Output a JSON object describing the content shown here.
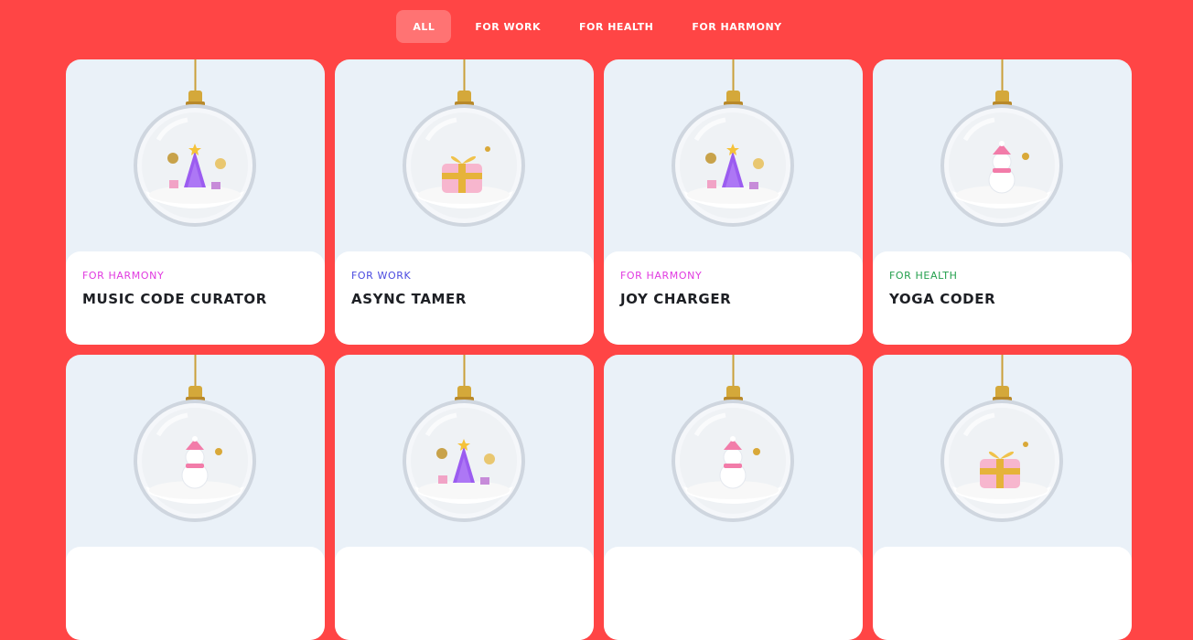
{
  "tabs": [
    {
      "label": "ALL",
      "active": true
    },
    {
      "label": "FOR WORK",
      "active": false
    },
    {
      "label": "FOR HEALTH",
      "active": false
    },
    {
      "label": "FOR HARMONY",
      "active": false
    }
  ],
  "colors": {
    "background": "#ff4545",
    "harmony": "#e13be0",
    "work": "#4a4ae0",
    "health": "#25a04e",
    "card_image_bg": "#eaf1f8"
  },
  "cards": [
    {
      "category": "FOR HARMONY",
      "category_color": "#e13be0",
      "title": "MUSIC CODE CURATOR",
      "ornament": "tree-ornament-icon"
    },
    {
      "category": "FOR WORK",
      "category_color": "#4a4ae0",
      "title": "ASYNC TAMER",
      "ornament": "gift-ornament-icon"
    },
    {
      "category": "FOR HARMONY",
      "category_color": "#e13be0",
      "title": "JOY CHARGER",
      "ornament": "tree-ornament-icon"
    },
    {
      "category": "FOR HEALTH",
      "category_color": "#25a04e",
      "title": "YOGA CODER",
      "ornament": "snowman-ornament-icon"
    },
    {
      "category": "",
      "category_color": "#e13be0",
      "title": "",
      "ornament": "snowman-ornament-icon"
    },
    {
      "category": "",
      "category_color": "#e13be0",
      "title": "",
      "ornament": "tree-ornament-icon"
    },
    {
      "category": "",
      "category_color": "#e13be0",
      "title": "",
      "ornament": "snowman-ornament-icon"
    },
    {
      "category": "",
      "category_color": "#e13be0",
      "title": "",
      "ornament": "gift-ornament-icon"
    }
  ]
}
